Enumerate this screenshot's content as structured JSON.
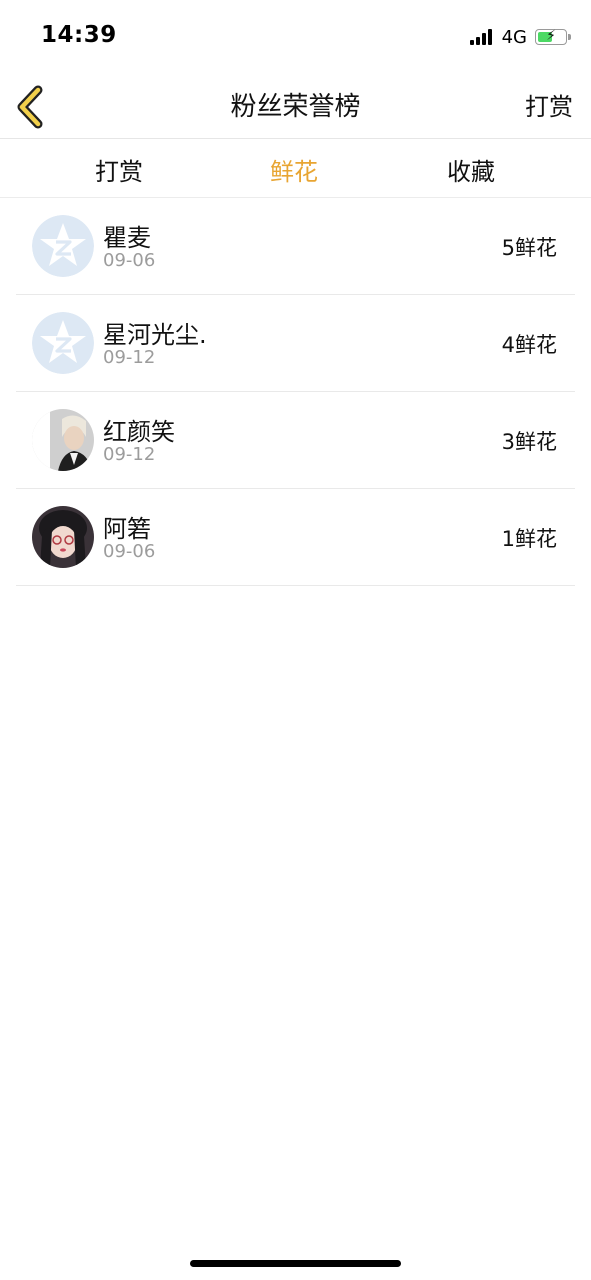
{
  "status_bar": {
    "time": "14:39",
    "network": "4G"
  },
  "nav": {
    "title": "粉丝荣誉榜",
    "action": "打赏",
    "accent_color": "#e8a532"
  },
  "tabs": [
    {
      "label": "打赏",
      "active": false
    },
    {
      "label": "鲜花",
      "active": true
    },
    {
      "label": "收藏",
      "active": false
    }
  ],
  "list": [
    {
      "name": "瞿麦",
      "date": "09-06",
      "amount": "5鲜花",
      "avatar": "default-avatar-icon"
    },
    {
      "name": "星河光尘.",
      "date": "09-12",
      "amount": "4鲜花",
      "avatar": "default-avatar-icon"
    },
    {
      "name": "红颜笑",
      "date": "09-12",
      "amount": "3鲜花",
      "avatar": "user-photo-avatar"
    },
    {
      "name": "阿箬",
      "date": "09-06",
      "amount": "1鲜花",
      "avatar": "user-photo-avatar"
    }
  ]
}
